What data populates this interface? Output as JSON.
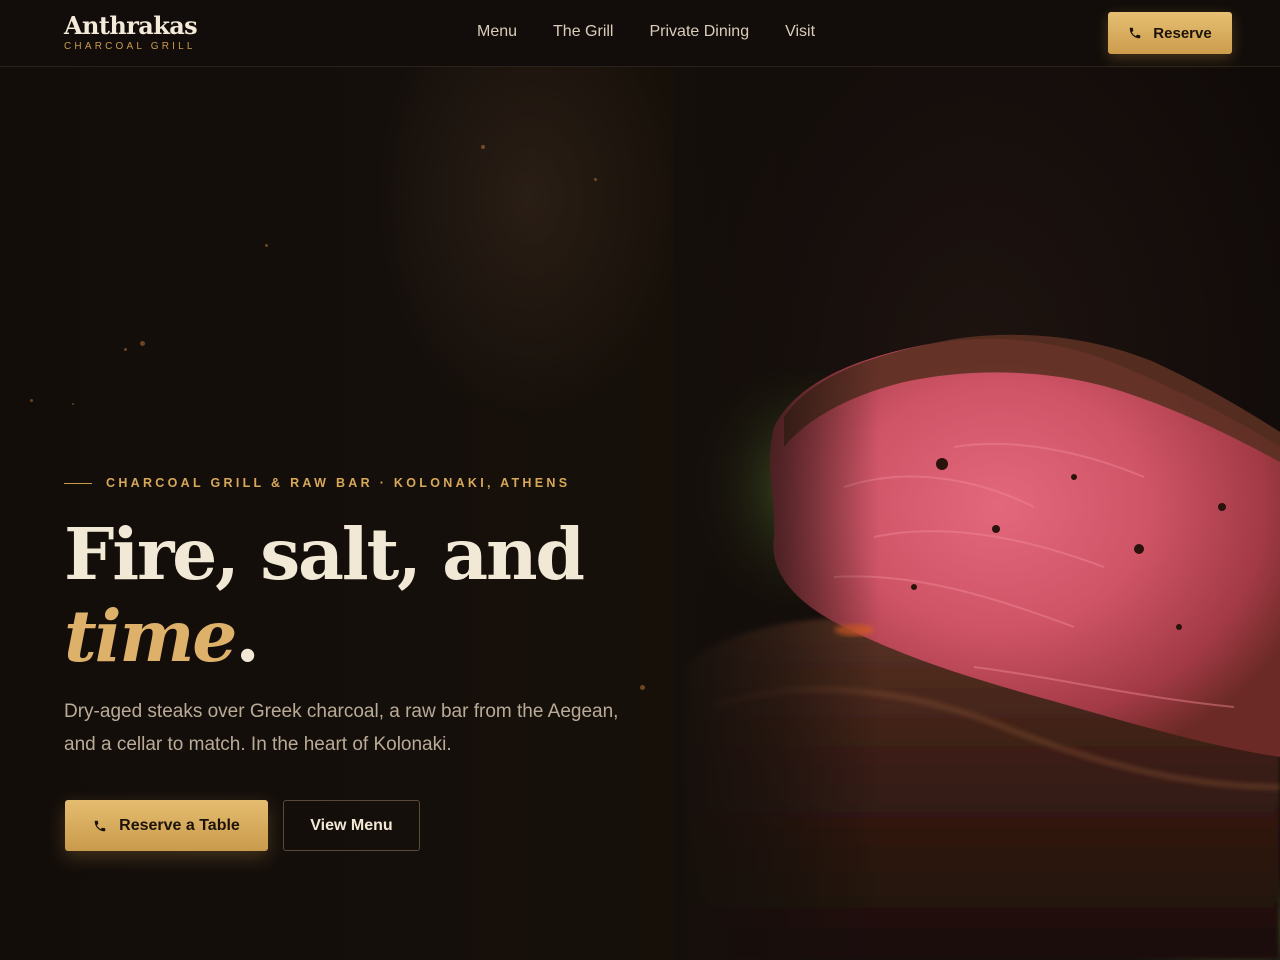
{
  "brand": {
    "name": "Anthrakas",
    "subtitle": "CHARCOAL GRILL"
  },
  "nav": {
    "items": [
      {
        "label": "Menu"
      },
      {
        "label": "The Grill"
      },
      {
        "label": "Private Dining"
      },
      {
        "label": "Visit"
      }
    ]
  },
  "header": {
    "reserve_label": "Reserve",
    "reserve_icon": "phone-icon"
  },
  "hero": {
    "eyebrow": "CHARCOAL GRILL & RAW BAR · KOLONAKI, ATHENS",
    "headline_line1": "Fire, salt, and",
    "headline_accent": "time",
    "headline_period": ".",
    "lede": "Dry-aged steaks over Greek charcoal, a raw bar from the Aegean, and a cellar to match. In the heart of Kolonaki.",
    "primary_cta": "Reserve a Table",
    "primary_cta_icon": "phone-icon",
    "secondary_cta": "View Menu",
    "image_subject": "sliced grilled steak"
  },
  "colors": {
    "background": "#130e0b",
    "accent_gold": "#ddb16a",
    "text_light": "#f1e8d6",
    "text_muted": "#b9ab97"
  }
}
